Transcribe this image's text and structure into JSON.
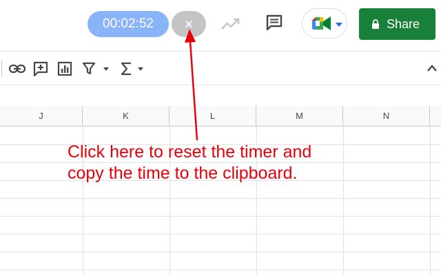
{
  "header": {
    "timer": {
      "value": "00:02:52",
      "color": "#8ab4f8"
    },
    "reset_button": {
      "icon": "close-icon"
    },
    "trend_icon": "trending-up-icon",
    "comment_icon": "comment-icon",
    "meet_button": {
      "icon": "google-meet-icon"
    },
    "share_button": {
      "label": "Share",
      "icon": "lock-icon",
      "color": "#188038"
    }
  },
  "toolbar": {
    "icons": [
      "insert-link-icon",
      "insert-comment-icon",
      "insert-chart-icon",
      "filter-icon",
      "functions-icon"
    ],
    "collapse_icon": "chevron-up-icon"
  },
  "sheet": {
    "columns": [
      "J",
      "K",
      "L",
      "M",
      "N"
    ]
  },
  "annotation": {
    "line1": "Click here to reset the timer and",
    "line2": "copy the time to the clipboard.",
    "color": "#e8000b"
  }
}
